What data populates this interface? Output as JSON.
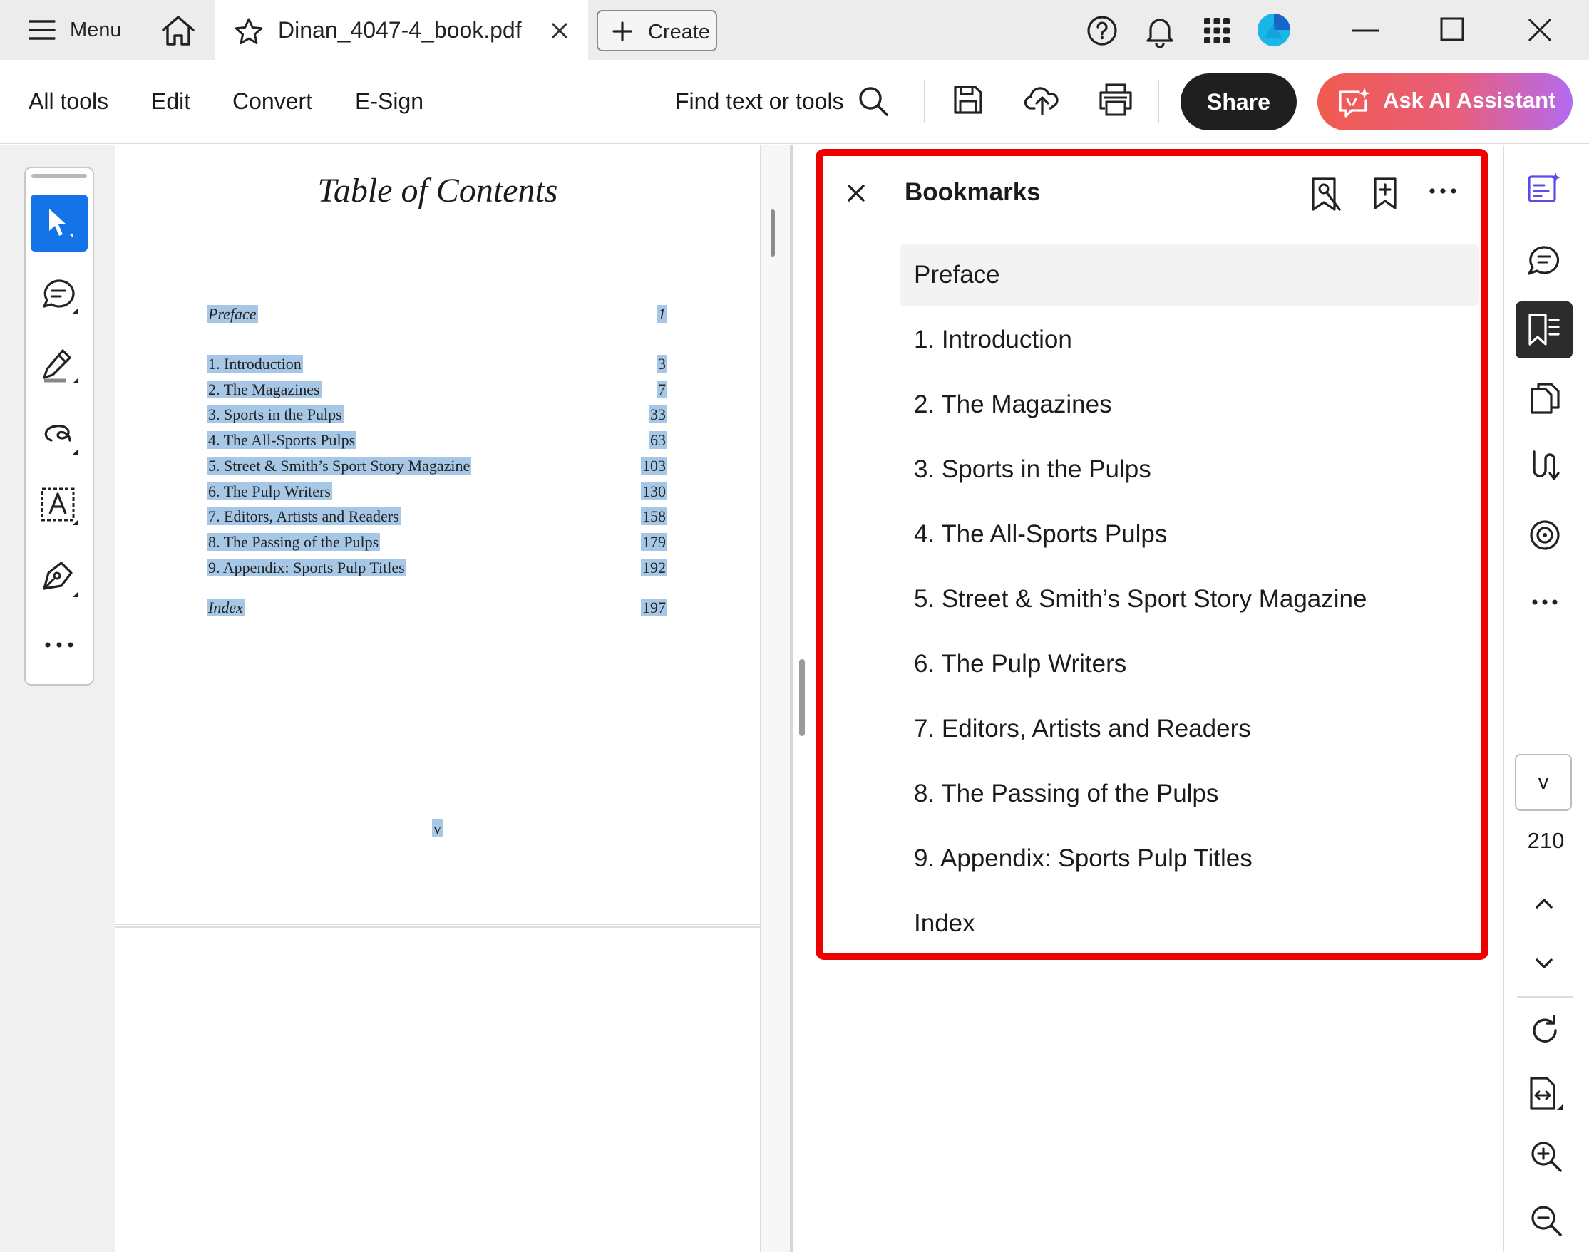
{
  "titlebar": {
    "menu_label": "Menu",
    "tab_title": "Dinan_4047-4_book.pdf",
    "create_label": "Create"
  },
  "toolbar": {
    "all_tools": "All tools",
    "edit": "Edit",
    "convert": "Convert",
    "esign": "E-Sign",
    "find_placeholder": "Find text or tools",
    "share": "Share",
    "ask_ai": "Ask AI Assistant"
  },
  "document": {
    "heading": "Table of Contents",
    "preface": {
      "title": "Preface",
      "page": "1"
    },
    "chapters": [
      {
        "title": "1.  Introduction",
        "page": "3"
      },
      {
        "title": "2.  The Magazines",
        "page": "7"
      },
      {
        "title": "3.  Sports in the Pulps",
        "page": "33"
      },
      {
        "title": "4.  The All-Sports Pulps",
        "page": "63"
      },
      {
        "title": "5.  Street & Smith’s Sport Story Magazine",
        "page": "103"
      },
      {
        "title": "6.  The Pulp Writers",
        "page": "130"
      },
      {
        "title": "7.  Editors, Artists and Readers",
        "page": "158"
      },
      {
        "title": "8.  The Passing of the Pulps",
        "page": "179"
      },
      {
        "title": "9.  Appendix: Sports Pulp Titles",
        "page": "192"
      }
    ],
    "index": {
      "title": "Index",
      "page": "197"
    },
    "folio": "v"
  },
  "bookmarks": {
    "title": "Bookmarks",
    "items": [
      "Preface",
      "1. Introduction",
      "2. The Magazines",
      "3. Sports in the Pulps",
      "4. The All-Sports Pulps",
      "5. Street & Smith’s Sport Story Magazine",
      "6. The Pulp Writers",
      "7. Editors, Artists and Readers",
      "8. The Passing of the Pulps",
      "9. Appendix: Sports Pulp Titles",
      "Index"
    ],
    "selected": "Preface"
  },
  "page_nav": {
    "current_page": "v",
    "total_pages": "210"
  },
  "colors": {
    "accent_blue": "#1473e6",
    "highlight": "#a6c8e6",
    "frame_red": "#ee0000",
    "share_bg": "#1f1f1f"
  }
}
